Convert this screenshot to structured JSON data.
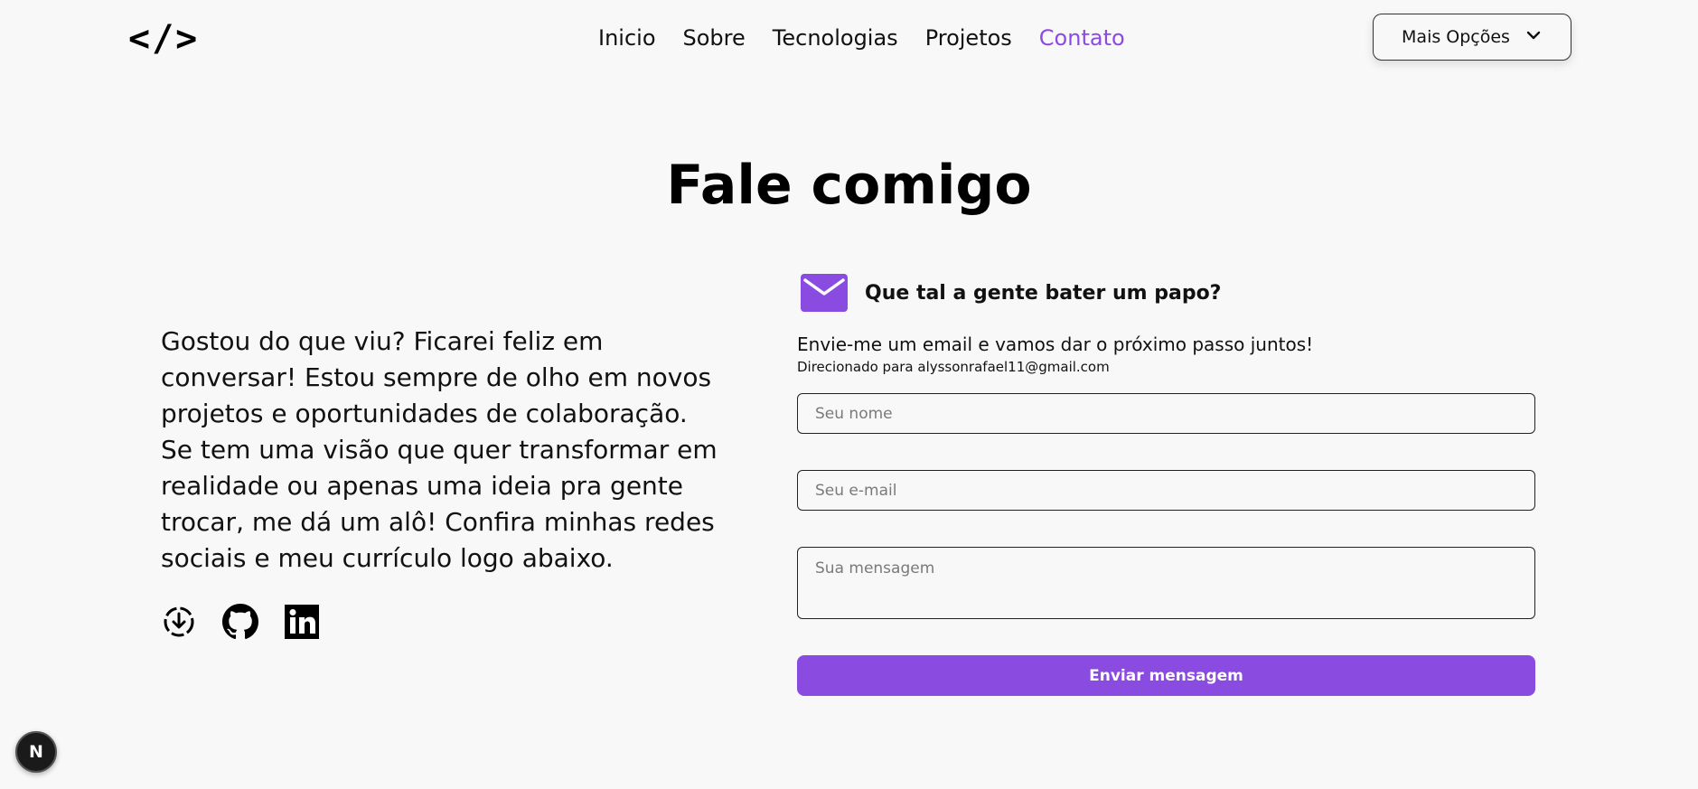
{
  "header": {
    "logo_text": "</>",
    "nav": [
      {
        "label": "Inicio",
        "active": false
      },
      {
        "label": "Sobre",
        "active": false
      },
      {
        "label": "Tecnologias",
        "active": false
      },
      {
        "label": "Projetos",
        "active": false
      },
      {
        "label": "Contato",
        "active": true
      }
    ],
    "more_button": {
      "label": "Mais Opções",
      "icon": "chevron-down-icon"
    }
  },
  "main": {
    "title": "Fale comigo",
    "description": "Gostou do que viu? Ficarei feliz em conversar! Estou sempre de olho em novos projetos e oportunidades de colaboração. Se tem uma visão que quer transformar em realidade ou apenas uma ideia pra gente trocar, me dá um alô! Confira minhas redes sociais e meu currículo logo abaixo.",
    "socials": [
      {
        "name": "download-resume-icon"
      },
      {
        "name": "github-icon"
      },
      {
        "name": "linkedin-icon"
      }
    ]
  },
  "contact": {
    "icon": "mail-icon",
    "heading": "Que tal a gente bater um papo?",
    "intro": "Envie-me um email e vamos dar o próximo passo juntos!",
    "redirect": "Direcionado para alyssonrafael11@gmail.com",
    "form": {
      "name_placeholder": "Seu nome",
      "email_placeholder": "Seu e-mail",
      "message_placeholder": "Sua mensagem",
      "submit_label": "Enviar mensagem"
    }
  },
  "badge": {
    "label": "N"
  },
  "colors": {
    "accent": "#8a4be0",
    "background": "#f8f8f8"
  }
}
